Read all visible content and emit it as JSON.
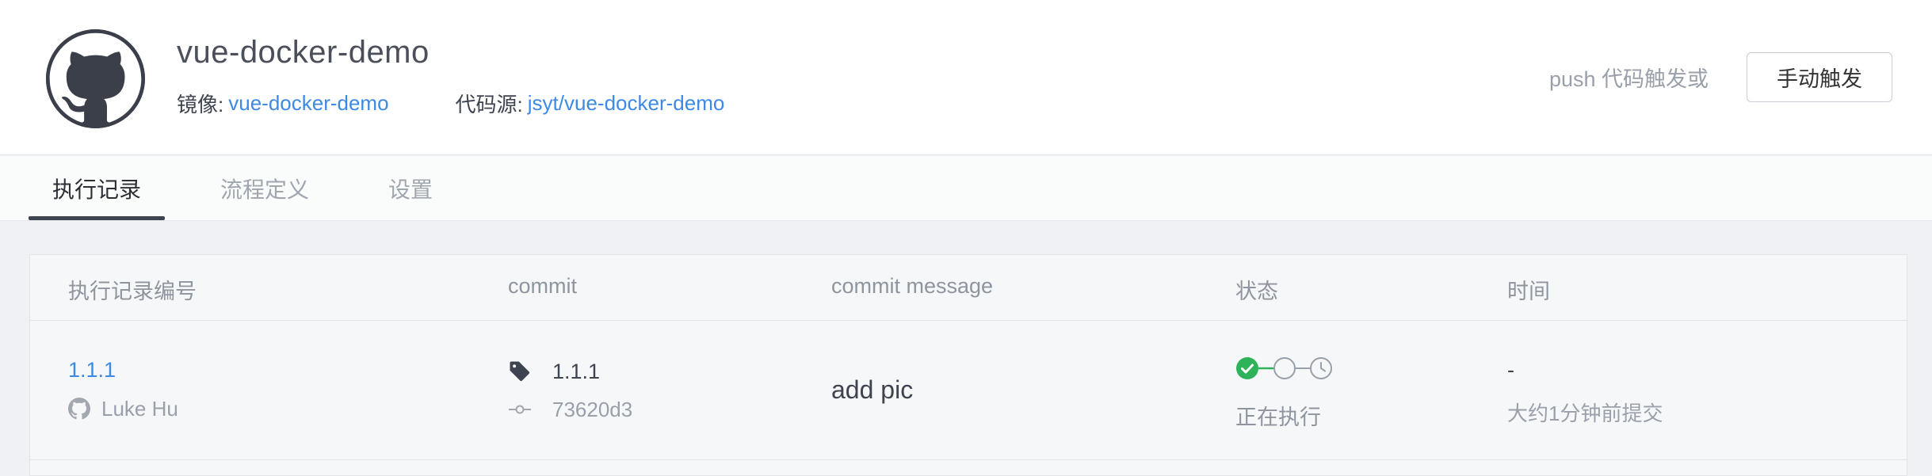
{
  "header": {
    "repo_name": "vue-docker-demo",
    "image_label": "镜像:",
    "image_value": "vue-docker-demo",
    "source_label": "代码源:",
    "source_value": "jsyt/vue-docker-demo",
    "trigger_hint": "push 代码触发或",
    "trigger_button": "手动触发"
  },
  "tabs": [
    {
      "label": "执行记录",
      "active": true
    },
    {
      "label": "流程定义",
      "active": false
    },
    {
      "label": "设置",
      "active": false
    }
  ],
  "table": {
    "columns": [
      "执行记录编号",
      "commit",
      "commit message",
      "状态",
      "时间"
    ],
    "rows": [
      {
        "run_id": "1.1.1",
        "author": "Luke Hu",
        "commit_tag": "1.1.1",
        "commit_hash": "73620d3",
        "commit_message": "add pic",
        "status": "正在执行",
        "time": "-",
        "time_relative": "大约1分钟前提交"
      }
    ]
  },
  "colors": {
    "link": "#3d8ae4",
    "success": "#2fb35a",
    "logo_bg": "#3a3f4a"
  },
  "icons": {
    "logo": "github-logo-icon",
    "author": "github-icon",
    "tag": "tag-icon",
    "commit": "commit-icon",
    "status_steps": [
      "check-circle-icon",
      "empty-circle-icon",
      "clock-icon"
    ]
  }
}
